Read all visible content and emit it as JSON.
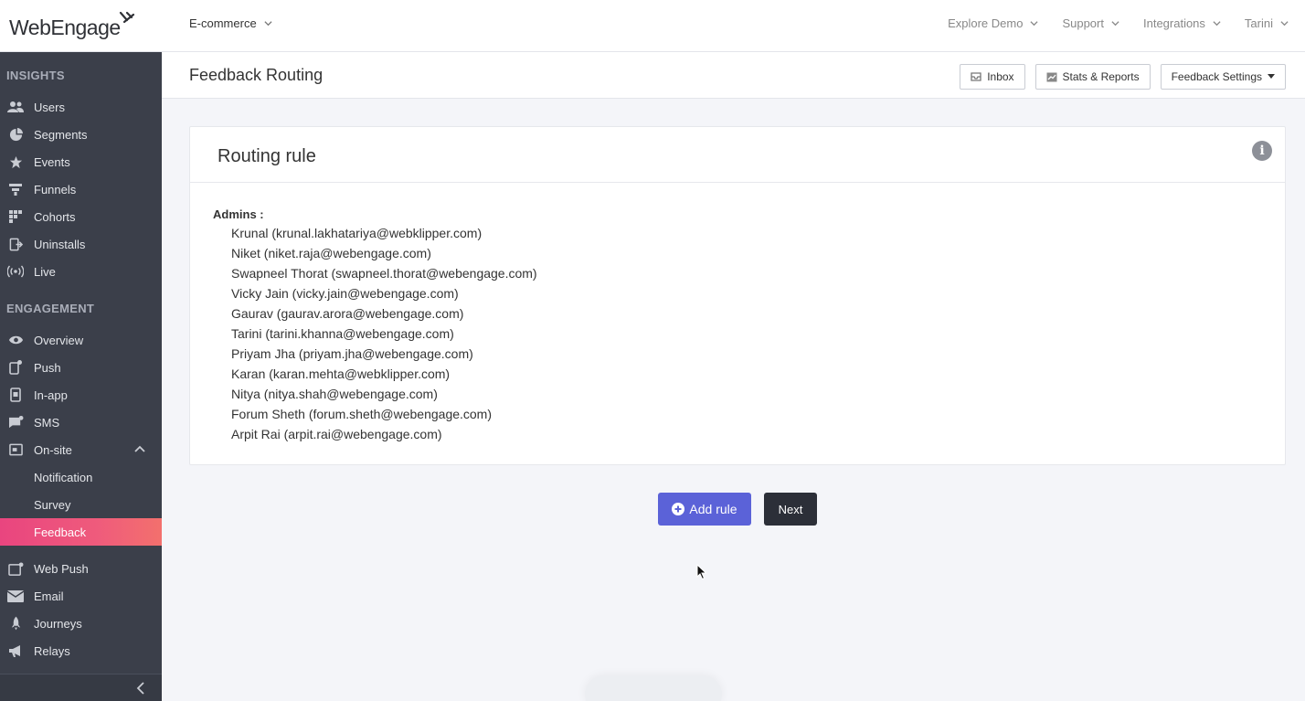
{
  "brand": {
    "logo_text": "WebEngage"
  },
  "topbar": {
    "project": "E-commerce",
    "nav": [
      "Explore Demo",
      "Support",
      "Integrations",
      "Tarini"
    ]
  },
  "sidebar": {
    "insights_title": "INSIGHTS",
    "insights": [
      "Users",
      "Segments",
      "Events",
      "Funnels",
      "Cohorts",
      "Uninstalls",
      "Live"
    ],
    "engagement_title": "ENGAGEMENT",
    "engagement": [
      "Overview",
      "Push",
      "In-app",
      "SMS",
      "On-site"
    ],
    "onsite_sub": [
      "Notification",
      "Survey",
      "Feedback"
    ],
    "more": [
      "Web Push",
      "Email",
      "Journeys",
      "Relays"
    ]
  },
  "page": {
    "title": "Feedback Routing",
    "buttons": {
      "inbox": "Inbox",
      "stats": "Stats & Reports",
      "settings": "Feedback Settings"
    }
  },
  "card": {
    "title": "Routing rule",
    "admins_label": "Admins :",
    "admins": [
      "Krunal (krunal.lakhatariya@webklipper.com)",
      "Niket (niket.raja@webengage.com)",
      "Swapneel Thorat (swapneel.thorat@webengage.com)",
      "Vicky Jain (vicky.jain@webengage.com)",
      "Gaurav (gaurav.arora@webengage.com)",
      "Tarini (tarini.khanna@webengage.com)",
      "Priyam Jha (priyam.jha@webengage.com)",
      "Karan (karan.mehta@webklipper.com)",
      "Nitya (nitya.shah@webengage.com)",
      "Forum Sheth (forum.sheth@webengage.com)",
      "Arpit Rai (arpit.rai@webengage.com)"
    ]
  },
  "actions": {
    "add_rule": "Add rule",
    "next": "Next"
  },
  "colors": {
    "accent": "#5b62d8",
    "active": "#ef5b7c",
    "sidebar": "#3b3f4a"
  }
}
